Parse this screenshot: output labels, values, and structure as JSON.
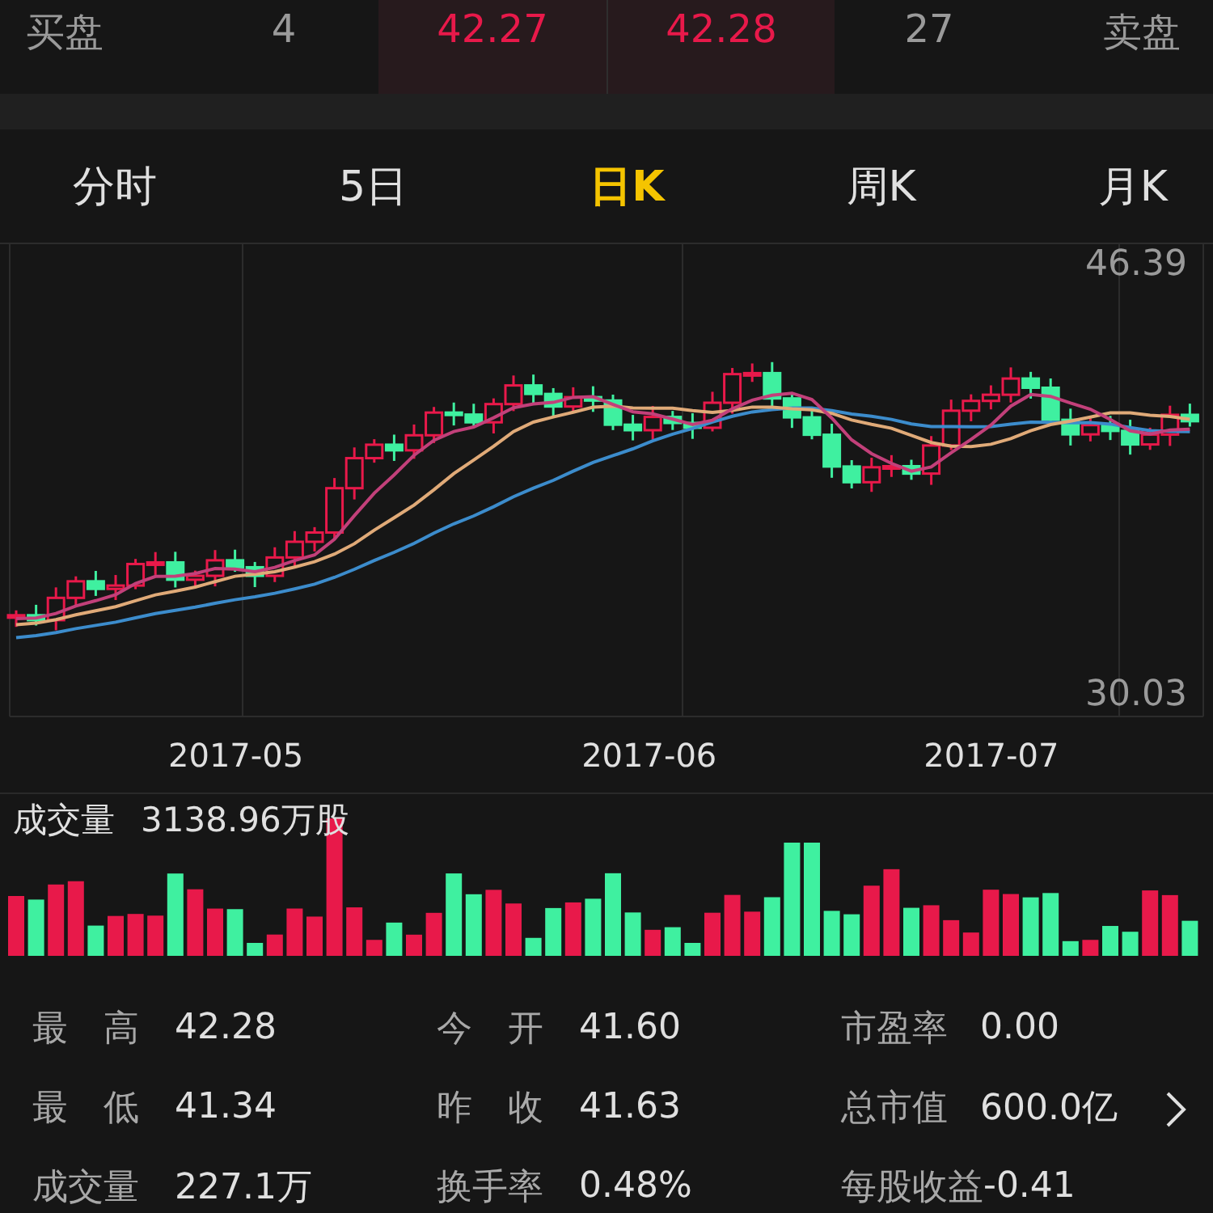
{
  "quote_bar": {
    "bid_label": "买盘",
    "bid_volume": "4",
    "bid_price": "42.27",
    "ask_price": "42.28",
    "ask_volume": "27",
    "ask_label": "卖盘"
  },
  "period_tabs": [
    {
      "label": "分时",
      "selected": false
    },
    {
      "label": "5日",
      "selected": false
    },
    {
      "label": "日K",
      "selected": true
    },
    {
      "label": "周K",
      "selected": false
    },
    {
      "label": "月K",
      "selected": false
    }
  ],
  "kline_chart": {
    "y_max": "46.39",
    "y_min": "30.03",
    "x_labels": [
      "2017-05",
      "2017-06",
      "2017-07"
    ]
  },
  "volume": {
    "label": "成交量",
    "value": "3138.96万股"
  },
  "stats": [
    {
      "label": "最高",
      "value": "42.28"
    },
    {
      "label": "今开",
      "value": "41.60"
    },
    {
      "label": "市盈率",
      "value": "0.00"
    },
    {
      "label": "最低",
      "value": "41.34"
    },
    {
      "label": "昨收",
      "value": "41.63"
    },
    {
      "label": "总市值",
      "value": "600.0亿"
    },
    {
      "label": "成交量",
      "value": "227.1万"
    },
    {
      "label": "换手率",
      "value": "0.48%"
    },
    {
      "label": "每股收益",
      "value": "-0.41"
    }
  ]
}
